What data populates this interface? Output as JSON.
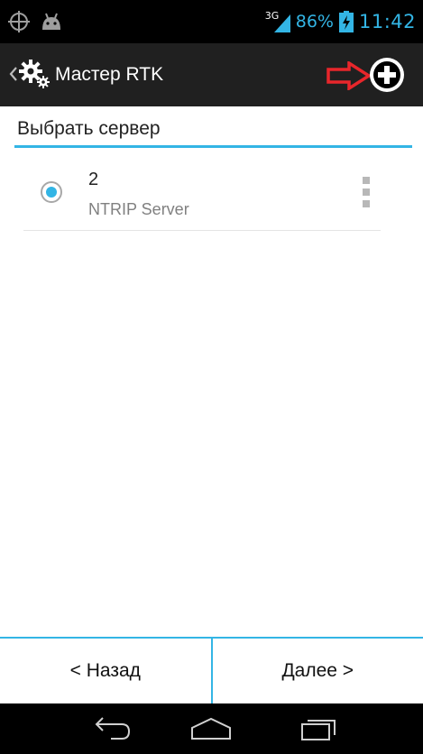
{
  "status_bar": {
    "network_label": "3G",
    "battery_percent": "86%",
    "clock": "11:42",
    "icons": [
      "gps-icon",
      "android-debug-icon",
      "signal-icon",
      "battery-charging-icon"
    ]
  },
  "action_bar": {
    "title": "Мастер RTK",
    "icons": [
      "back-caret-icon",
      "settings-gears-icon",
      "red-arrow-icon",
      "add-icon"
    ]
  },
  "section": {
    "title": "Выбрать сервер"
  },
  "servers": [
    {
      "name": "2",
      "type": "NTRIP Server",
      "selected": true
    }
  ],
  "buttons": {
    "back_label": "< Назад",
    "next_label": "Далее >"
  },
  "nav": {
    "icons": [
      "back-icon",
      "home-icon",
      "recent-apps-icon"
    ]
  },
  "colors": {
    "accent": "#33b5e5",
    "action_bar_bg": "#202020",
    "status_bar_bg": "#000000",
    "arrow_red": "#e8262b"
  }
}
